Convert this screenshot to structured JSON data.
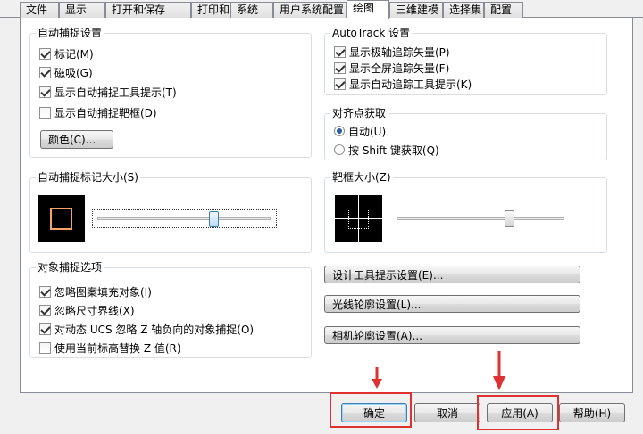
{
  "tabs": [
    {
      "label": "文件"
    },
    {
      "label": "显示"
    },
    {
      "label": "打开和保存"
    },
    {
      "label": "打印和发布"
    },
    {
      "label": "系统"
    },
    {
      "label": "用户系统配置"
    },
    {
      "label": "绘图"
    },
    {
      "label": "三维建模"
    },
    {
      "label": "选择集"
    },
    {
      "label": "配置"
    }
  ],
  "autosnap": {
    "title": "自动捕捉设置",
    "items": [
      {
        "label": "标记(M)",
        "checked": true
      },
      {
        "label": "磁吸(G)",
        "checked": true
      },
      {
        "label": "显示自动捕捉工具提示(T)",
        "checked": true
      },
      {
        "label": "显示自动捕捉靶框(D)",
        "checked": false
      }
    ],
    "color_button": "颜色(C)..."
  },
  "autotrack": {
    "title": "AutoTrack 设置",
    "items": [
      {
        "label": "显示极轴追踪矢量(P)",
        "checked": true
      },
      {
        "label": "显示全屏追踪矢量(F)",
        "checked": true
      },
      {
        "label": "显示自动追踪工具提示(K)",
        "checked": true
      }
    ]
  },
  "alignment": {
    "title": "对齐点获取",
    "options": [
      {
        "label": "自动(U)",
        "selected": true
      },
      {
        "label": "按 Shift 键获取(Q)",
        "selected": false
      }
    ]
  },
  "marker_size": {
    "title": "自动捕捉标记大小(S)",
    "level": 0.67
  },
  "aperture_size": {
    "title": "靶框大小(Z)",
    "level": 0.67
  },
  "osnap": {
    "title": "对象捕捉选项",
    "items": [
      {
        "label": "忽略图案填充对象(I)",
        "checked": true
      },
      {
        "label": "忽略尺寸界线(X)",
        "checked": true
      },
      {
        "label": "对动态 UCS 忽略 Z 轴负向的对象捕捉(O)",
        "checked": true
      },
      {
        "label": "使用当前标高替换 Z 值(R)",
        "checked": false
      }
    ]
  },
  "side_buttons": {
    "design_tooltip": "设计工具提示设置(E)...",
    "light_glyph": "光线轮廓设置(L)...",
    "camera_glyph": "相机轮廓设置(A)..."
  },
  "footer": {
    "ok": "确定",
    "cancel": "取消",
    "apply": "应用(A)",
    "help": "帮助(H)"
  },
  "colors": {
    "highlight": "#e03131",
    "marker": "#f4a46a"
  }
}
